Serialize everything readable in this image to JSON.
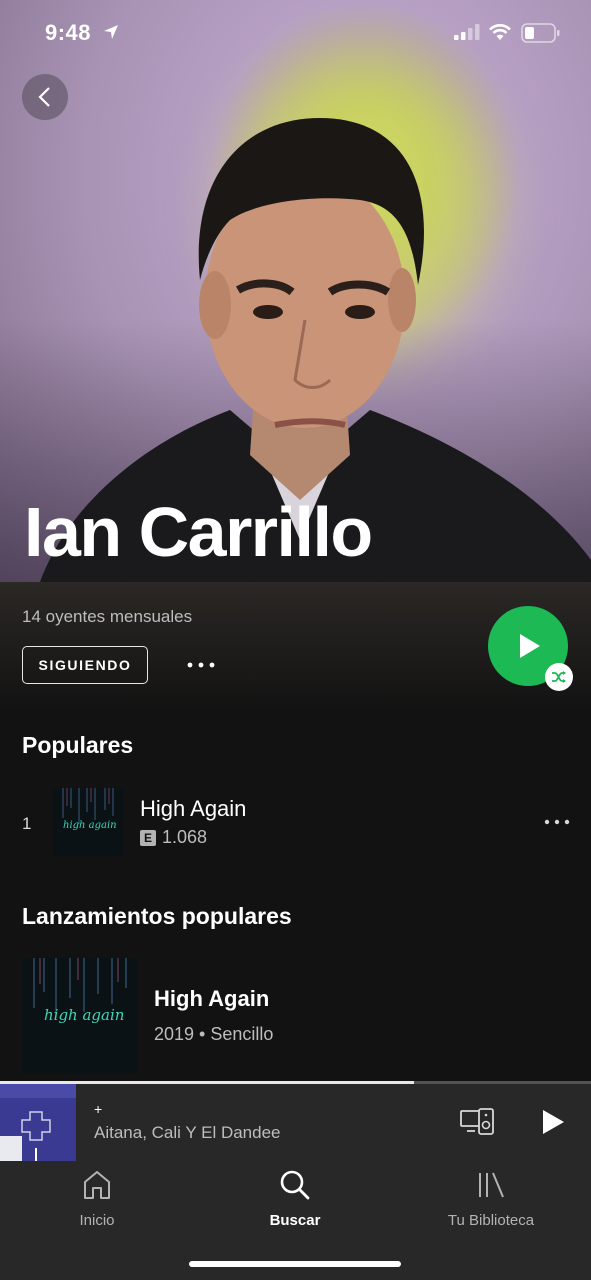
{
  "status_bar": {
    "time": "9:48"
  },
  "artist": {
    "name": "Ian Carrillo",
    "monthly_listeners": "14 oyentes mensuales",
    "follow_label": "SIGUIENDO"
  },
  "popular": {
    "title": "Populares",
    "tracks": [
      {
        "number": "1",
        "title": "High Again",
        "explicit_badge": "E",
        "plays": "1.068",
        "cover_text": "high again"
      }
    ]
  },
  "releases": {
    "title": "Lanzamientos populares",
    "items": [
      {
        "title": "High Again",
        "subtitle": "2019 • Sencillo",
        "cover_text": "high again"
      }
    ]
  },
  "now_playing": {
    "title": "+",
    "artist": "Aitana, Cali Y El Dandee",
    "progress": 0.7
  },
  "tabs": [
    {
      "label": "Inicio",
      "icon": "home-icon",
      "active": false
    },
    {
      "label": "Buscar",
      "icon": "search-icon",
      "active": true
    },
    {
      "label": "Tu Biblioteca",
      "icon": "library-icon",
      "active": false
    }
  ],
  "colors": {
    "accent": "#1db954",
    "background": "#121212",
    "bar": "#282828"
  }
}
